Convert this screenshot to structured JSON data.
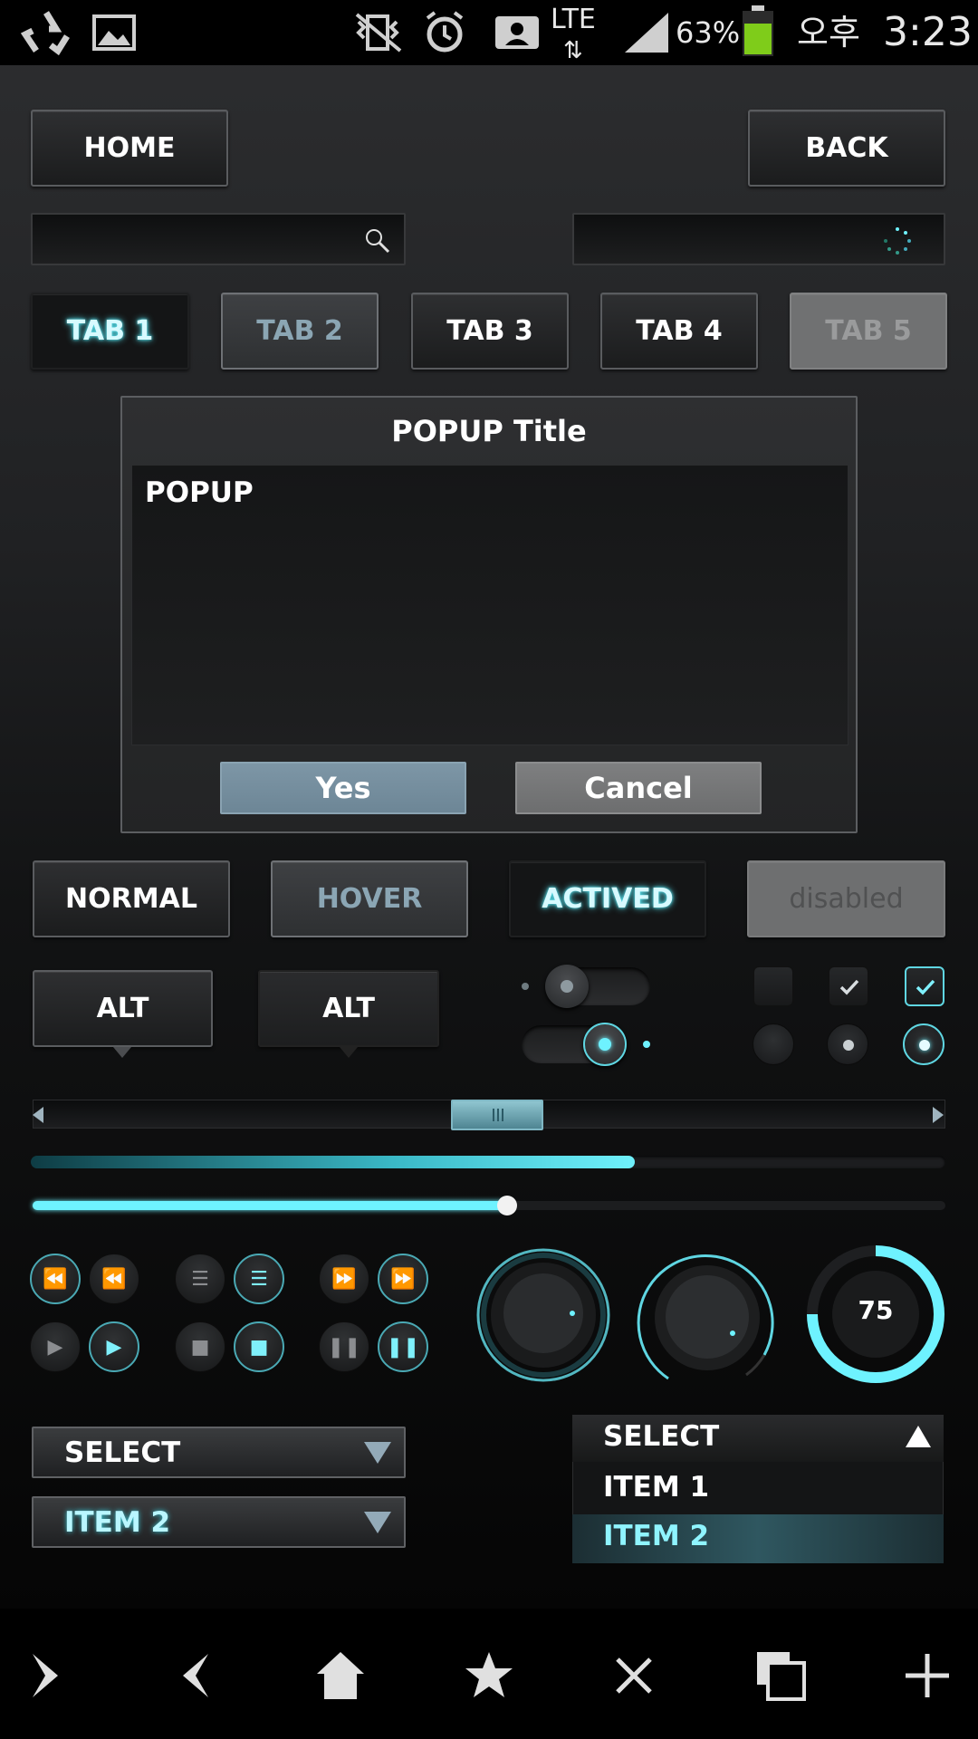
{
  "status_bar": {
    "battery": "63%",
    "network": "LTE",
    "ampm": "오후",
    "time": "3:23",
    "icons": [
      "recycle-icon",
      "gallery-icon",
      "mute-vibrate-icon",
      "alarm-icon",
      "contact-card-icon",
      "lte-data-icon",
      "signal-icon",
      "battery-icon"
    ]
  },
  "top_buttons": {
    "home": "HOME",
    "back": "BACK"
  },
  "tabs": [
    {
      "label": "TAB 1",
      "state": "active"
    },
    {
      "label": "TAB 2",
      "state": "hover"
    },
    {
      "label": "TAB 3",
      "state": "normal"
    },
    {
      "label": "TAB 4",
      "state": "normal"
    },
    {
      "label": "TAB 5",
      "state": "disabled"
    }
  ],
  "popup": {
    "title": "POPUP Title",
    "body": "POPUP",
    "yes": "Yes",
    "cancel": "Cancel"
  },
  "state_buttons": {
    "normal": "NORMAL",
    "hover": "HOVER",
    "actived": "ACTIVED",
    "disabled": "disabled"
  },
  "alt_buttons": [
    "ALT",
    "ALT"
  ],
  "toggles": [
    {
      "on": false
    },
    {
      "on": true
    }
  ],
  "checkboxes": [
    {
      "checked": false
    },
    {
      "checked": true
    },
    {
      "checked": true,
      "active": true
    }
  ],
  "radios": [
    {
      "selected": false
    },
    {
      "selected": true
    },
    {
      "selected": true,
      "active": true
    }
  ],
  "scrollbar_position": 0.49,
  "progress": 0.66,
  "seek": 0.52,
  "knob_value": "75",
  "selects": {
    "closed_1": "SELECT",
    "closed_2": "ITEM 2",
    "open_header": "SELECT",
    "items": [
      "ITEM 1",
      "ITEM 2"
    ],
    "selected_index": 1
  },
  "nav_icons": [
    "forward-icon",
    "back-icon",
    "home-icon",
    "star-icon",
    "close-icon",
    "window-icon",
    "plus-icon"
  ],
  "colors": {
    "accent": "#6ef2ff",
    "yes_button": "#7d96a6",
    "battery": "#7fcc1a"
  }
}
